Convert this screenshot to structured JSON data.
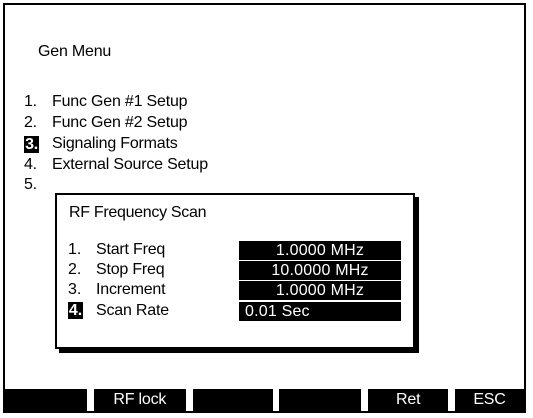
{
  "menu": {
    "title": "Gen Menu",
    "items": [
      {
        "number": "1.",
        "label": "Func Gen #1 Setup",
        "selected": false
      },
      {
        "number": "2.",
        "label": "Func Gen #2 Setup",
        "selected": false
      },
      {
        "number": "3.",
        "label": "Signaling Formats",
        "selected": true
      },
      {
        "number": "4.",
        "label": "External Source Setup",
        "selected": false
      },
      {
        "number": "5.",
        "label": "",
        "selected": false
      }
    ]
  },
  "popup": {
    "title": "RF Frequency Scan",
    "fields": [
      {
        "number": "1.",
        "label": "Start Freq",
        "value": "1.0000 MHz",
        "selected": false
      },
      {
        "number": "2.",
        "label": "Stop Freq",
        "value": "10.0000 MHz",
        "selected": false
      },
      {
        "number": "3.",
        "label": "Increment",
        "value": "1.0000 MHz",
        "selected": false
      },
      {
        "number": "4.",
        "label": "Scan Rate",
        "value": "0.01 Sec",
        "selected": true
      }
    ]
  },
  "softkeys": [
    "",
    "RF lock",
    "",
    "",
    "Ret",
    "ESC"
  ],
  "colors": {
    "background": "#ffffff",
    "foreground": "#000000",
    "highlight": "#000000",
    "highlight_text": "#ffffff"
  }
}
